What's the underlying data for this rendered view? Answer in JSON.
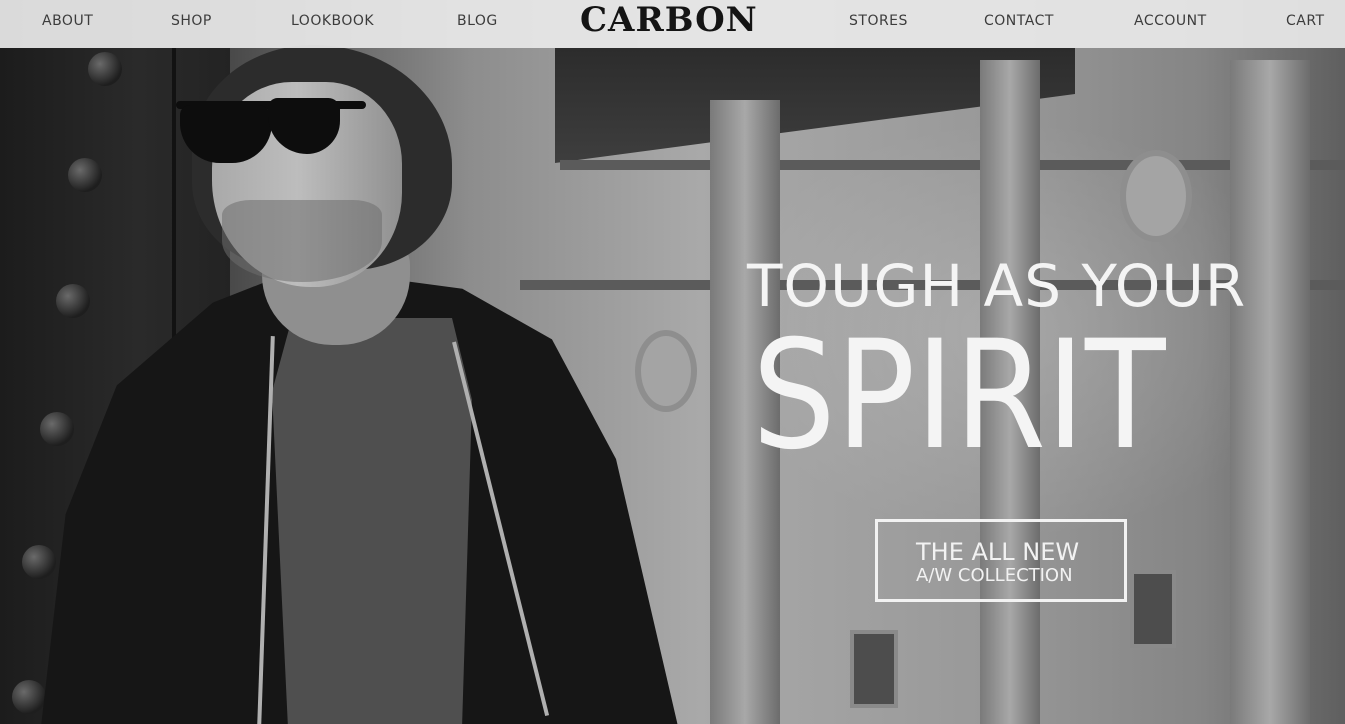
{
  "nav": {
    "left": [
      "ABOUT",
      "SHOP",
      "LOOKBOOK",
      "BLOG"
    ],
    "brand": "CARBON",
    "right": [
      "STORES",
      "CONTACT",
      "ACCOUNT",
      "CART"
    ]
  },
  "hero": {
    "headline_top": "TOUGH AS YOUR",
    "headline_big": "SPIRIT",
    "cta_line1": "THE ALL NEW",
    "cta_line2": "A/W COLLECTION"
  },
  "colors": {
    "nav_background": "#e8e8e8",
    "nav_text": "#3c3c3c",
    "brand_text": "#141414",
    "hero_text": "#f4f4f4"
  }
}
